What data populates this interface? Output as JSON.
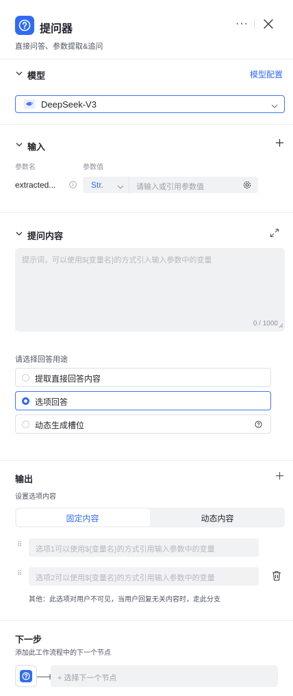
{
  "header": {
    "title": "提问器",
    "subtitle": "直接问答、参数提取&追问",
    "more_label": "···"
  },
  "model": {
    "section_title": "模型",
    "config_link": "模型配置",
    "selected_model": "DeepSeek-V3"
  },
  "input": {
    "section_title": "输入",
    "col_name": "参数名",
    "col_value": "参数值",
    "param_name": "extracted...",
    "param_type": "Str.",
    "value_placeholder": "请输入或引用参数值"
  },
  "question": {
    "section_title": "提问内容",
    "placeholder": "提示词，可以使用${变量名}的方式引入输入参数中的变量",
    "counter": "0 / 1000"
  },
  "answer_purpose": {
    "label": "请选择回答用途",
    "options": [
      "提取直接回答内容",
      "选项回答",
      "动态生成槽位"
    ],
    "selected_index": 1
  },
  "output": {
    "section_title": "输出",
    "sub_label": "设置选项内容",
    "tabs": [
      "固定内容",
      "动态内容"
    ],
    "active_tab": 0,
    "option1_placeholder": "选项1可以使用${变量名}的方式引用输入参数中的变量",
    "option2_placeholder": "选项2可以使用${变量名}的方式引用输入参数中的变量",
    "other_note": "其他：此选项对用户不可见，当用户回复无关内容时，走此分支"
  },
  "next": {
    "section_title": "下一步",
    "description": "添加此工作流程中的下一个节点",
    "select_placeholder": "+ 选择下一个节点"
  },
  "colors": {
    "accent": "#2f6bf5",
    "border": "#dcdfe5",
    "muted": "#8a8f99"
  }
}
